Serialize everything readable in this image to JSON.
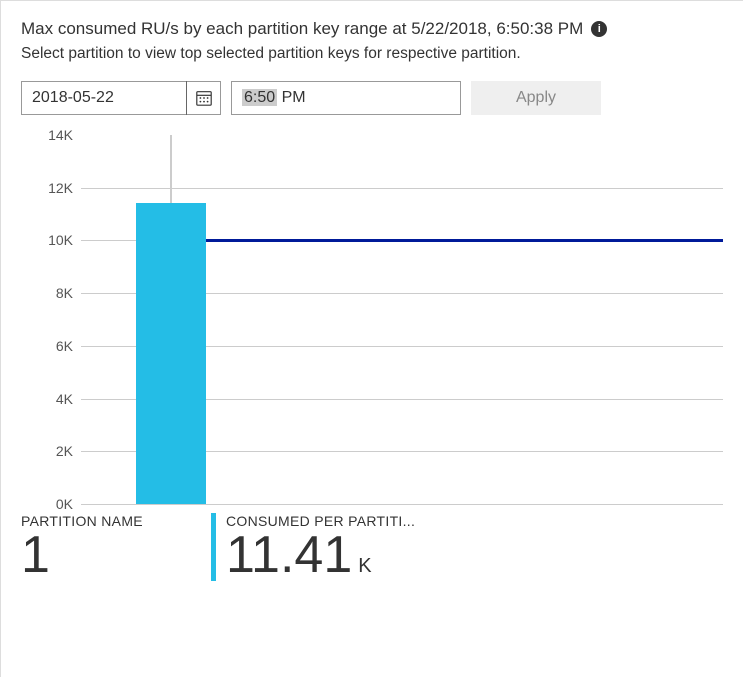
{
  "title": "Max consumed RU/s by each partition key range at 5/22/2018, 6:50:38 PM",
  "subtitle": "Select partition to view top selected partition keys for respective partition.",
  "controls": {
    "date_value": "2018-05-22",
    "time_value_hl": "6:50",
    "time_value_rest": " PM",
    "apply_label": "Apply"
  },
  "metrics": {
    "left_label": "PARTITION NAME",
    "left_value": "1",
    "right_label": "CONSUMED PER PARTITI...",
    "right_value": "11.41",
    "right_unit": "K"
  },
  "chart_data": {
    "type": "bar",
    "categories": [
      "1"
    ],
    "values": [
      11410
    ],
    "threshold": 10000,
    "ylabel": "",
    "xlabel": "",
    "y_ticks": [
      "0K",
      "2K",
      "4K",
      "6K",
      "8K",
      "10K",
      "12K",
      "14K"
    ],
    "ylim": [
      0,
      14000
    ]
  }
}
